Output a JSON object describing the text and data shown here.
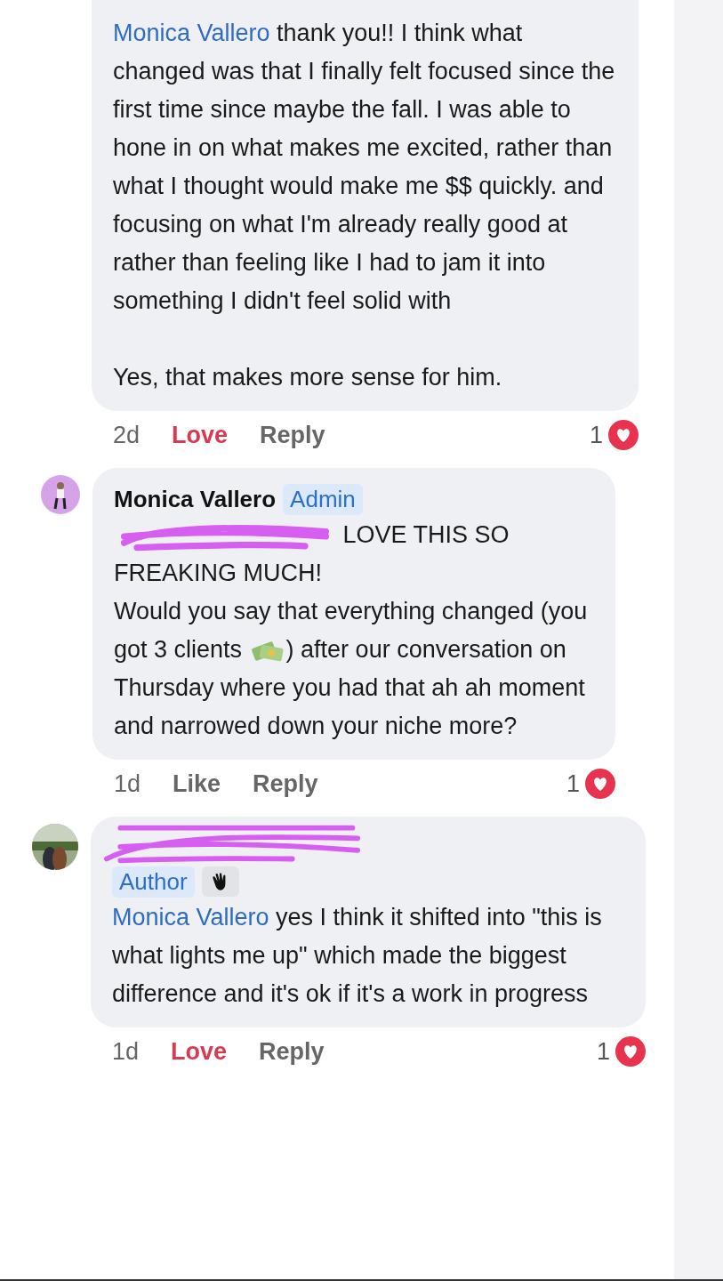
{
  "comments": [
    {
      "paragraphs": [
        [
          {
            "kind": "mention",
            "text": "Monica Vallero"
          },
          {
            "kind": "text",
            "text": " thank you!! I think what changed was that I finally felt focused since the first time since maybe the fall. I was able to hone in on what makes me excited, rather than what I thought would make me $$ quickly. and  focusing on what I'm already really good at rather than feeling like I had to jam it into something I didn't feel solid with"
          }
        ],
        [
          {
            "kind": "text",
            "text": "Yes, that makes more sense for him."
          }
        ]
      ],
      "time": "2d",
      "reaction": "Love",
      "reacted": true,
      "reply": "Reply",
      "count": "1"
    },
    {
      "avatar": {
        "kind": "figure"
      },
      "author": "Monica Vallero",
      "badge": "Admin",
      "paragraphs": [
        [
          {
            "kind": "redacted"
          },
          {
            "kind": "text",
            "text": " LOVE THIS SO FREAKING MUCH!"
          }
        ],
        [
          {
            "kind": "text",
            "text": "Would you say that everything changed (you got 3 clients "
          },
          {
            "kind": "money"
          },
          {
            "kind": "text",
            "text": ") after our conversation on Thursday where you had that ah ah moment and narrowed down your niche more?"
          }
        ]
      ],
      "time": "1d",
      "reaction": "Like",
      "reacted": false,
      "reply": "Reply",
      "count": "1"
    },
    {
      "avatar": {
        "kind": "photo"
      },
      "name_redacted": true,
      "badge": "Author",
      "paragraphs": [
        [
          {
            "kind": "mention",
            "text": "Monica Vallero"
          },
          {
            "kind": "text",
            "text": " yes I think it shifted into \"this is what lights me up\" which made the biggest difference and it's ok if it's a work in progress"
          }
        ]
      ],
      "time": "1d",
      "reaction": "Love",
      "reacted": true,
      "reply": "Reply",
      "count": "1"
    }
  ]
}
